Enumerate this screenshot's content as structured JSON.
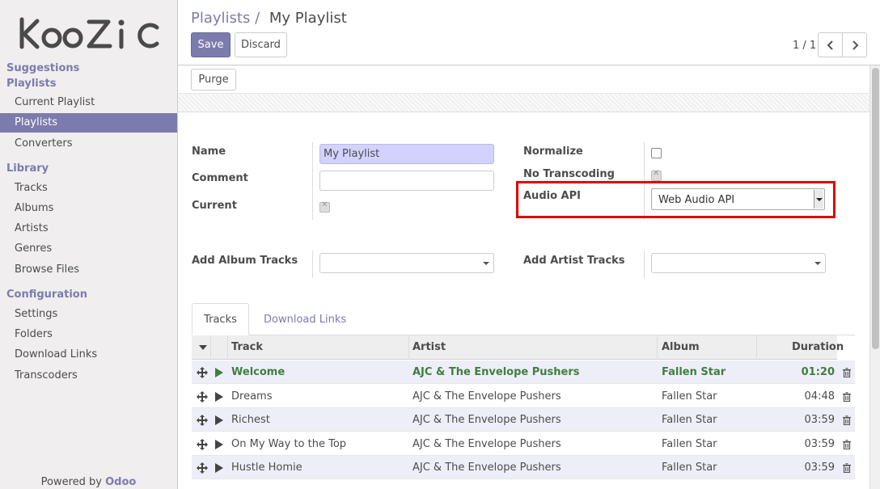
{
  "app": {
    "logo_text": "KooZic",
    "powered_by_prefix": "Powered by",
    "powered_by_brand": "Odoo"
  },
  "sidebar": {
    "sections": [
      {
        "title": "Suggestions",
        "items": []
      },
      {
        "title": "Playlists",
        "items": [
          {
            "label": "Current Playlist",
            "active": false
          },
          {
            "label": "Playlists",
            "active": true
          },
          {
            "label": "Converters",
            "active": false
          }
        ]
      },
      {
        "title": "Library",
        "items": [
          {
            "label": "Tracks",
            "active": false
          },
          {
            "label": "Albums",
            "active": false
          },
          {
            "label": "Artists",
            "active": false
          },
          {
            "label": "Genres",
            "active": false
          },
          {
            "label": "Browse Files",
            "active": false
          }
        ]
      },
      {
        "title": "Configuration",
        "items": [
          {
            "label": "Settings",
            "active": false
          },
          {
            "label": "Folders",
            "active": false
          },
          {
            "label": "Download Links",
            "active": false
          },
          {
            "label": "Transcoders",
            "active": false
          }
        ]
      }
    ]
  },
  "header": {
    "breadcrumb_parent": "Playlists",
    "breadcrumb_sep": "/",
    "breadcrumb_current": "My Playlist",
    "save_label": "Save",
    "discard_label": "Discard",
    "pager": "1 / 1"
  },
  "actions": {
    "purge_label": "Purge"
  },
  "form": {
    "name_label": "Name",
    "name_value": "My Playlist",
    "comment_label": "Comment",
    "comment_value": "",
    "current_label": "Current",
    "current_checked": true,
    "normalize_label": "Normalize",
    "normalize_checked": false,
    "no_transcoding_label": "No Transcoding",
    "no_transcoding_checked": true,
    "audio_api_label": "Audio API",
    "audio_api_value": "Web Audio API",
    "add_album_tracks_label": "Add Album Tracks",
    "add_artist_tracks_label": "Add Artist Tracks"
  },
  "tabs": [
    {
      "label": "Tracks",
      "active": true
    },
    {
      "label": "Download Links",
      "active": false
    }
  ],
  "table": {
    "columns": [
      "Track",
      "Artist",
      "Album",
      "Duration"
    ],
    "rows": [
      {
        "track": "Welcome",
        "artist": "AJC & The Envelope Pushers",
        "album": "Fallen Star",
        "duration": "01:20",
        "playing": true
      },
      {
        "track": "Dreams",
        "artist": "AJC & The Envelope Pushers",
        "album": "Fallen Star",
        "duration": "04:48",
        "playing": false
      },
      {
        "track": "Richest",
        "artist": "AJC & The Envelope Pushers",
        "album": "Fallen Star",
        "duration": "03:59",
        "playing": false
      },
      {
        "track": "On My Way to the Top",
        "artist": "AJC & The Envelope Pushers",
        "album": "Fallen Star",
        "duration": "03:59",
        "playing": false
      },
      {
        "track": "Hustle Homie",
        "artist": "AJC & The Envelope Pushers",
        "album": "Fallen Star",
        "duration": "03:59",
        "playing": false
      }
    ]
  },
  "colors": {
    "accent": "#7c7bad",
    "playing": "#3f7f3f",
    "highlight": "#e10000"
  }
}
